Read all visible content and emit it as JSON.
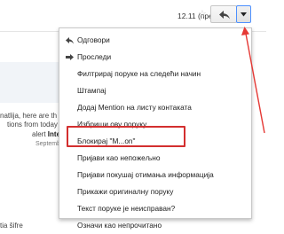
{
  "header": {
    "date": "12.11 (пре 2 сата)",
    "star_icon": "star-outline-icon",
    "reply_icon": "reply-arrow-icon",
    "more_icon": "dropdown-triangle-icon"
  },
  "background": {
    "line1": "natlija, here are th",
    "line2": "tions from today fo",
    "line3_prefix": "alert ",
    "line3_bold": "Internet za",
    "date": "September 2",
    "bottom": "tia šifre"
  },
  "menu": {
    "items": [
      {
        "label": "Одговори",
        "icon": "reply-icon"
      },
      {
        "label": "Проследи",
        "icon": "forward-icon"
      },
      {
        "label": "Филтрирај поруке на следећи начин",
        "icon": ""
      },
      {
        "label": "Штампај",
        "icon": ""
      },
      {
        "label": "Додај Mention на листу контаката",
        "icon": ""
      },
      {
        "label": "Избриши ову поруку",
        "icon": ""
      },
      {
        "label": "Блокирај \"M...on\"",
        "icon": ""
      },
      {
        "label": "Пријави као непожељно",
        "icon": ""
      },
      {
        "label": "Пријави покушај отимања информација",
        "icon": ""
      },
      {
        "label": "Прикажи оригиналну поруку",
        "icon": ""
      },
      {
        "label": "Текст поруке је неисправан?",
        "icon": ""
      },
      {
        "label": "Означи као непрочитано",
        "icon": ""
      }
    ]
  },
  "colors": {
    "highlight": "#d32f2f",
    "arrow": "#e53935"
  }
}
